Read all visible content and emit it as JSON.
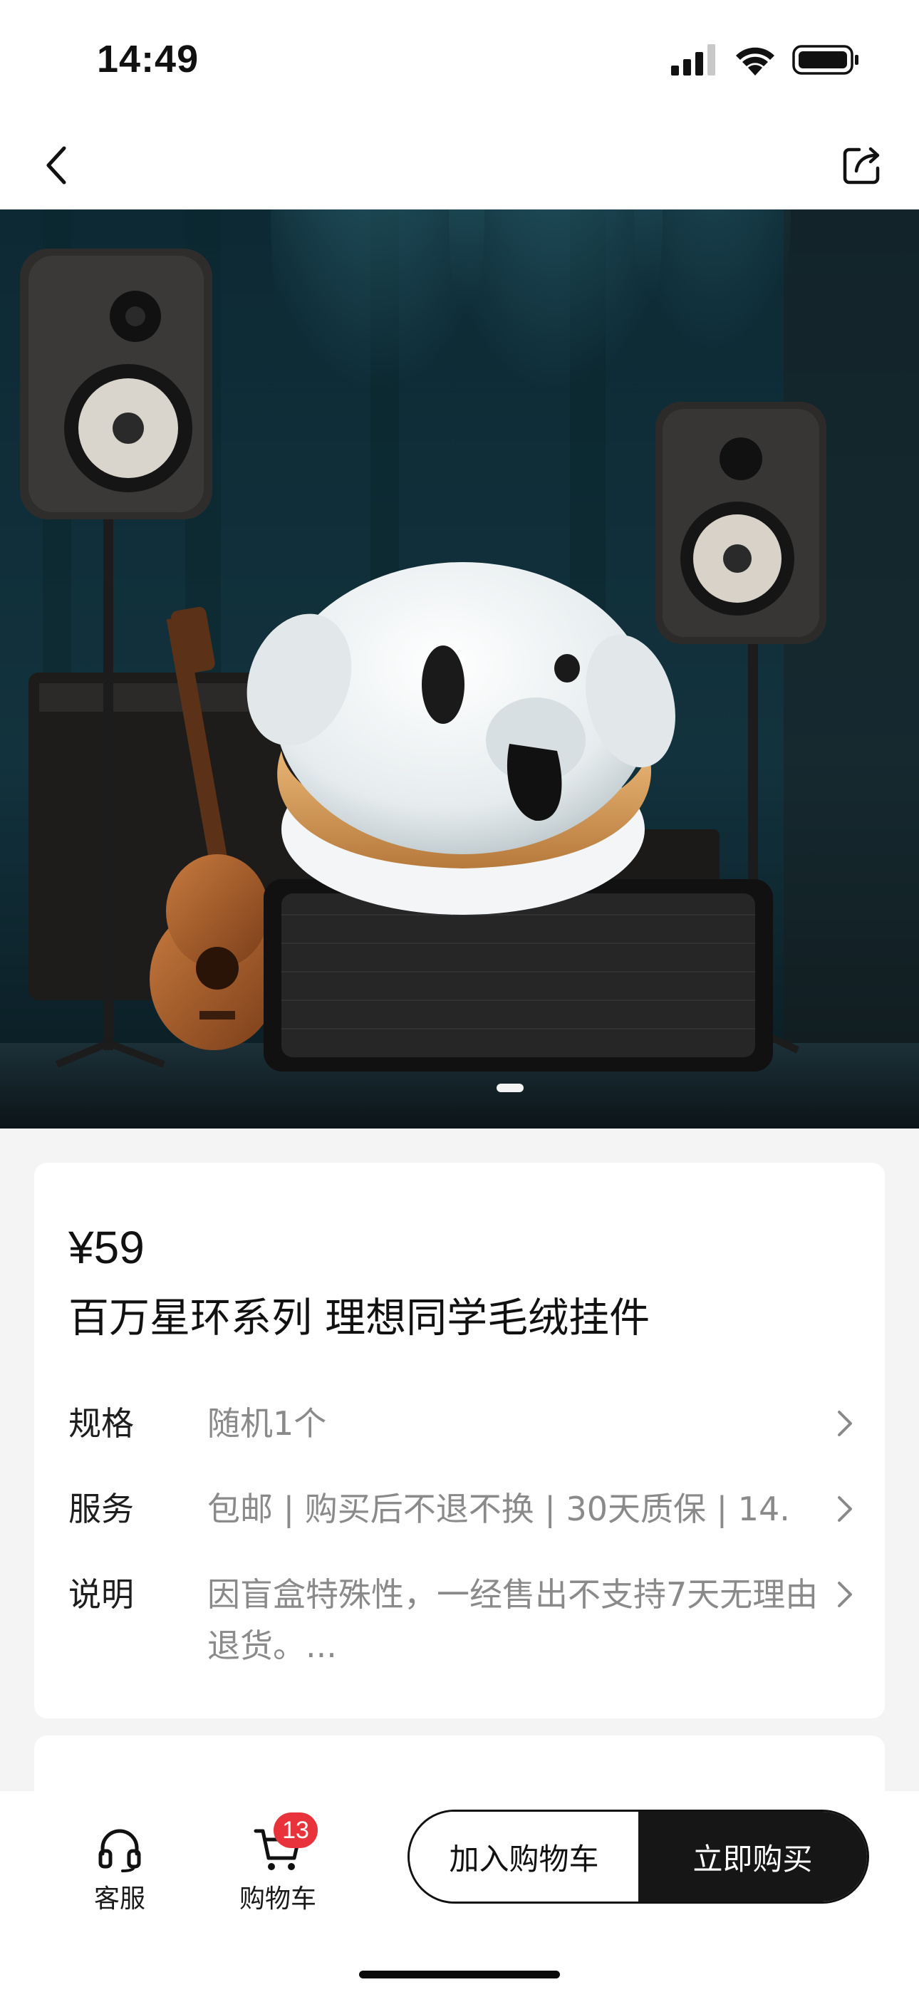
{
  "status_bar": {
    "time": "14:49"
  },
  "nav": {
    "back_icon": "chevron-left-icon",
    "share_icon": "share-icon"
  },
  "gallery": {
    "image": "plush-toy-on-stage-photo",
    "current_index": 1,
    "colors": {
      "backdrop": "#12323d",
      "indicator": "#ffffff"
    }
  },
  "product": {
    "price": "¥59",
    "title": "百万星环系列 理想同学毛绒挂件",
    "attributes": [
      {
        "label": "规格",
        "value": "随机1个"
      },
      {
        "label": "服务",
        "value": "包邮 | 购买后不退不换 | 30天质保 | 14..."
      },
      {
        "label": "说明",
        "value": "因盲盒特殊性，一经售出不支持7天无理由退货。..."
      }
    ]
  },
  "bottom_bar": {
    "service": {
      "label": "客服",
      "icon": "headset-icon"
    },
    "cart": {
      "label": "购物车",
      "icon": "cart-icon",
      "badge": "13"
    },
    "add_to_cart": "加入购物车",
    "buy_now": "立即购买",
    "colors": {
      "badge": "#e8333d",
      "buy_button": "#161616"
    }
  }
}
